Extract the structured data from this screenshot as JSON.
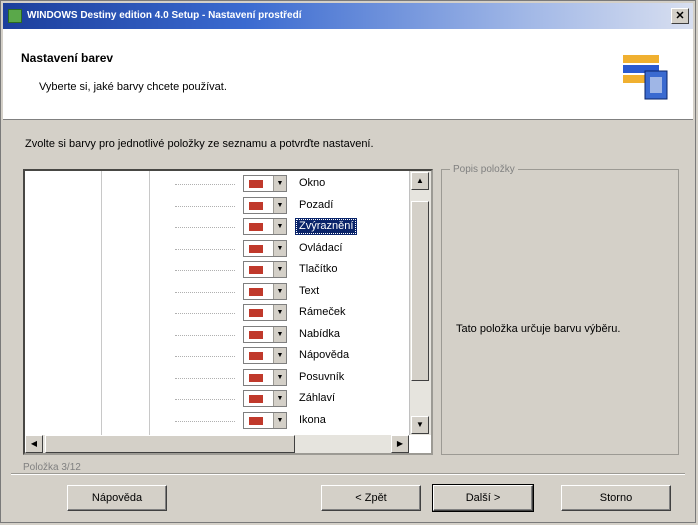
{
  "window": {
    "title": "WINDOWS Destiny edition 4.0 Setup - Nastavení prostředí"
  },
  "header": {
    "title": "Nastavení barev",
    "subtitle": "Vyberte si, jaké barvy chcete používat."
  },
  "instruction": "Zvolte si barvy pro jednotlivé položky ze seznamu a potvrďte nastavení.",
  "items": [
    {
      "label": "Okno"
    },
    {
      "label": "Pozadí"
    },
    {
      "label": "Zvýraznění"
    },
    {
      "label": "Ovládací"
    },
    {
      "label": "Tlačítko"
    },
    {
      "label": "Text"
    },
    {
      "label": "Rámeček"
    },
    {
      "label": "Nabídka"
    },
    {
      "label": "Nápověda"
    },
    {
      "label": "Posuvník"
    },
    {
      "label": "Záhlaví"
    },
    {
      "label": "Ikona"
    }
  ],
  "selected_index": 2,
  "description": {
    "legend": "Popis položky",
    "text": "Tato položka určuje barvu výběru."
  },
  "status": "Položka 3/12",
  "buttons": {
    "back": "< Zpět",
    "next": "Další >",
    "cancel": "Storno",
    "help": "Nápověda"
  },
  "colors": {
    "title_start": "#1c3f9c",
    "selection": "#0a246a",
    "swatch": "#c0392b"
  },
  "icons": {
    "app": "app-icon",
    "header": "setup-icon",
    "close": "close-icon"
  }
}
